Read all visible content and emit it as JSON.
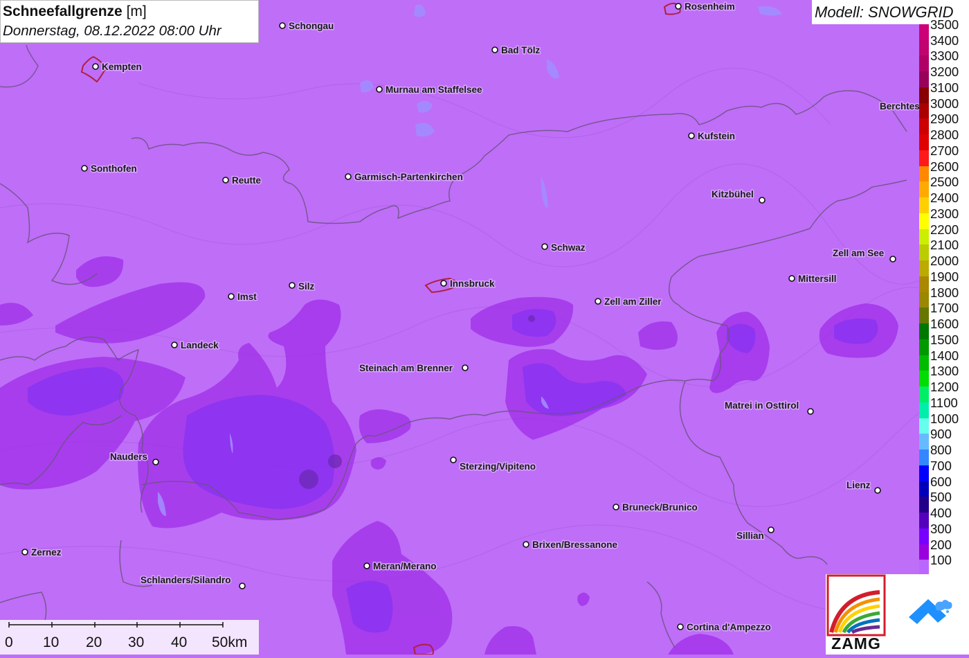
{
  "title": {
    "main": "Schneefallgrenze",
    "unit": "[m]",
    "datetime": "Donnerstag, 08.12.2022 08:00 Uhr"
  },
  "model": {
    "label": "Modell: SNOWGRID"
  },
  "legend": {
    "unit": "m",
    "entries": [
      {
        "label": "3500",
        "color": "#cc0077"
      },
      {
        "label": "3400",
        "color": "#c0046f"
      },
      {
        "label": "3300",
        "color": "#b00065"
      },
      {
        "label": "3200",
        "color": "#99005a"
      },
      {
        "label": "3100",
        "color": "#880000"
      },
      {
        "label": "3000",
        "color": "#aa0000"
      },
      {
        "label": "2900",
        "color": "#cc0000"
      },
      {
        "label": "2800",
        "color": "#e00000"
      },
      {
        "label": "2700",
        "color": "#ff1a1a"
      },
      {
        "label": "2600",
        "color": "#ff8800"
      },
      {
        "label": "2500",
        "color": "#ffaa00"
      },
      {
        "label": "2400",
        "color": "#ffd000"
      },
      {
        "label": "2300",
        "color": "#ffff00"
      },
      {
        "label": "2200",
        "color": "#ccee00"
      },
      {
        "label": "2100",
        "color": "#bbcc00"
      },
      {
        "label": "2000",
        "color": "#bbaa00"
      },
      {
        "label": "1900",
        "color": "#aa8800"
      },
      {
        "label": "1800",
        "color": "#998800"
      },
      {
        "label": "1700",
        "color": "#667700"
      },
      {
        "label": "1600",
        "color": "#007700"
      },
      {
        "label": "1500",
        "color": "#009900"
      },
      {
        "label": "1400",
        "color": "#00bb00"
      },
      {
        "label": "1300",
        "color": "#00dd00"
      },
      {
        "label": "1200",
        "color": "#00ee66"
      },
      {
        "label": "1100",
        "color": "#00eeaa"
      },
      {
        "label": "1000",
        "color": "#66ffee"
      },
      {
        "label": "900",
        "color": "#66bbff"
      },
      {
        "label": "800",
        "color": "#3388ff"
      },
      {
        "label": "700",
        "color": "#0000ff"
      },
      {
        "label": "600",
        "color": "#0000bb"
      },
      {
        "label": "500",
        "color": "#220088"
      },
      {
        "label": "400",
        "color": "#5500bb"
      },
      {
        "label": "300",
        "color": "#7700ff"
      },
      {
        "label": "200",
        "color": "#9900dd"
      },
      {
        "label": "100",
        "color": "#bb66ff"
      }
    ]
  },
  "scale": {
    "ticks": [
      "0",
      "10",
      "20",
      "30",
      "40",
      "50km"
    ]
  },
  "logos": {
    "zamg": "ZAMG"
  },
  "cities": [
    {
      "name": "Rosenheim"
    },
    {
      "name": "Schongau"
    },
    {
      "name": "Kempten"
    },
    {
      "name": "Bad Tölz"
    },
    {
      "name": "Murnau am Staffelsee"
    },
    {
      "name": "Berchtes"
    },
    {
      "name": "Kufstein"
    },
    {
      "name": "Sonthofen"
    },
    {
      "name": "Reutte"
    },
    {
      "name": "Garmisch-Partenkirchen"
    },
    {
      "name": "Kitzbühel"
    },
    {
      "name": "Schwaz"
    },
    {
      "name": "Zell am See"
    },
    {
      "name": "Mittersill"
    },
    {
      "name": "Imst"
    },
    {
      "name": "Silz"
    },
    {
      "name": "Innsbruck"
    },
    {
      "name": "Zell am Ziller"
    },
    {
      "name": "Landeck"
    },
    {
      "name": "Steinach am Brenner"
    },
    {
      "name": "Matrei in Osttirol"
    },
    {
      "name": "Nauders"
    },
    {
      "name": "Sterzing/Vipiteno"
    },
    {
      "name": "Lienz"
    },
    {
      "name": "Bruneck/Brunico"
    },
    {
      "name": "Sillian"
    },
    {
      "name": "Brixen/Bressanone"
    },
    {
      "name": "Zernez"
    },
    {
      "name": "Meran/Merano"
    },
    {
      "name": "Schlanders/Silandro"
    },
    {
      "name": "Cortina d'Ampezzo"
    }
  ]
}
